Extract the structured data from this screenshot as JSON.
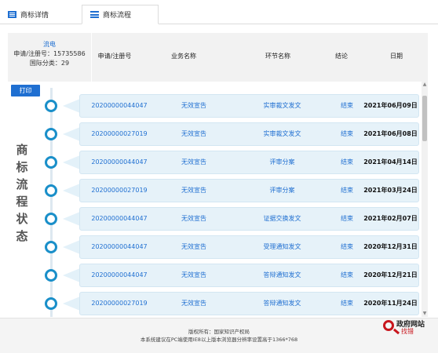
{
  "tabs": [
    {
      "label": "商标详情"
    },
    {
      "label": "商标流程"
    }
  ],
  "info": {
    "line1": "流电",
    "line2": "申请/注册号：15735586",
    "line3": "国际分类：29"
  },
  "columns": [
    "申请/注册号",
    "业务名称",
    "环节名称",
    "结论",
    "日期"
  ],
  "print_label": "打印",
  "vertical_title": [
    "商",
    "标",
    "流",
    "程",
    "状",
    "态"
  ],
  "rows": [
    {
      "reg": "20200000044047",
      "biz": "无效宣告",
      "node": "实审裁文发文",
      "result": "结束",
      "date": "2021年06月09日"
    },
    {
      "reg": "20200000027019",
      "biz": "无效宣告",
      "node": "实审裁文发文",
      "result": "结束",
      "date": "2021年06月08日"
    },
    {
      "reg": "20200000044047",
      "biz": "无效宣告",
      "node": "评审分案",
      "result": "结束",
      "date": "2021年04月14日"
    },
    {
      "reg": "20200000027019",
      "biz": "无效宣告",
      "node": "评审分案",
      "result": "结束",
      "date": "2021年03月24日"
    },
    {
      "reg": "20200000044047",
      "biz": "无效宣告",
      "node": "证据交换发文",
      "result": "结束",
      "date": "2021年02月07日"
    },
    {
      "reg": "20200000044047",
      "biz": "无效宣告",
      "node": "受理通知发文",
      "result": "结束",
      "date": "2020年12月31日"
    },
    {
      "reg": "20200000044047",
      "biz": "无效宣告",
      "node": "答辩通知发文",
      "result": "结束",
      "date": "2020年12月21日"
    },
    {
      "reg": "20200000027019",
      "biz": "无效宣告",
      "node": "答辩通知发文",
      "result": "结束",
      "date": "2020年11月24日"
    }
  ],
  "footer": {
    "line1": "版权所有：国家知识产权局",
    "line2": "本系统建议在PC端使用IE8以上版本浏览器分辨率设置高于1366*768"
  },
  "gov_logo": {
    "line1": "政府网站",
    "line2": "找错"
  },
  "colors": {
    "accent": "#1f6fd1",
    "timeline": "#1a8fc9",
    "card_bg": "#e6f2f9"
  }
}
